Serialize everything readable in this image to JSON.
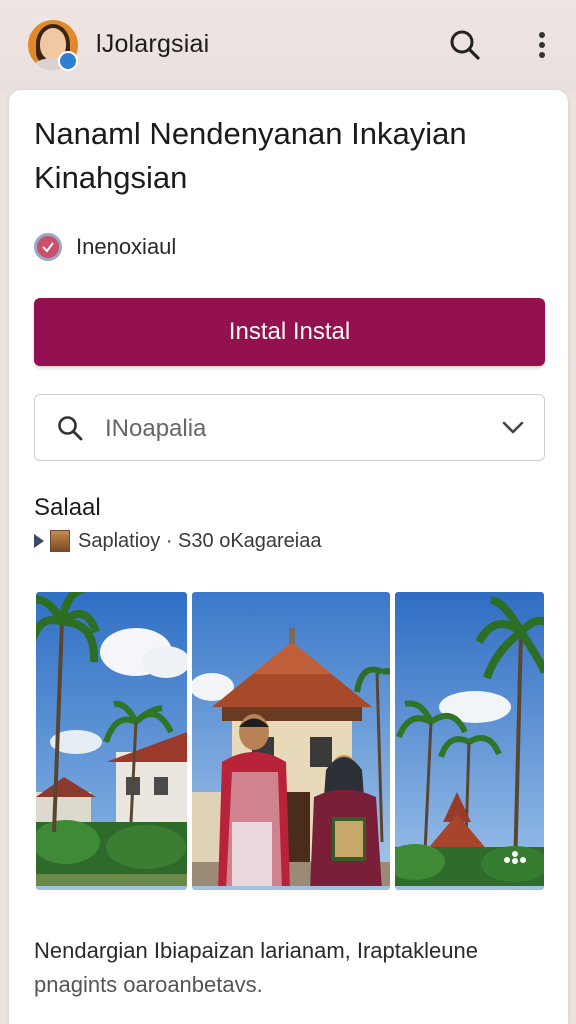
{
  "header": {
    "app_title": "lJolargsiai",
    "avatar_icon": "user-avatar-icon",
    "search_icon": "search-icon",
    "more_icon": "more-vert-icon"
  },
  "content": {
    "headline_line1": "Nanaml Nendenyanan Inkayian",
    "headline_line2": "Kinahgsian",
    "check_label": "Inenoxiaul",
    "install_button": "Instal Instal",
    "dropdown": {
      "value": "INoapalia"
    },
    "section_title": "Salaal",
    "meta_text": "Saplatioy · S30 oKagareiaa",
    "gallery": [
      {
        "name": "coastal-houses-photo"
      },
      {
        "name": "traditional-house-couple-photo"
      },
      {
        "name": "palm-trees-temple-photo"
      }
    ],
    "footer_line1": "Nendargian Ibiapaizan larianam, Iraptakleune",
    "footer_line2": "pnagints oaroanbetavs."
  },
  "colors": {
    "accent": "#93114e",
    "background": "#ece3e1",
    "card": "#ffffff"
  }
}
